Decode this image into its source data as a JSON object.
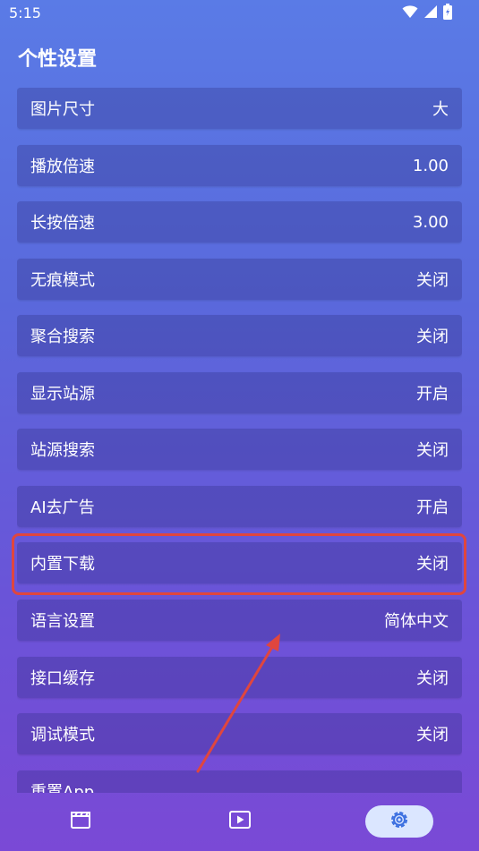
{
  "status_bar": {
    "time": "5:15",
    "icons": [
      "wifi-icon",
      "signal-icon",
      "battery-icon"
    ]
  },
  "page": {
    "title": "个性设置"
  },
  "settings": [
    {
      "label": "图片尺寸",
      "value": "大"
    },
    {
      "label": "播放倍速",
      "value": "1.00"
    },
    {
      "label": "长按倍速",
      "value": "3.00"
    },
    {
      "label": "无痕模式",
      "value": "关闭"
    },
    {
      "label": "聚合搜索",
      "value": "关闭"
    },
    {
      "label": "显示站源",
      "value": "开启"
    },
    {
      "label": "站源搜索",
      "value": "关闭"
    },
    {
      "label": "AI去广告",
      "value": "开启"
    },
    {
      "label": "内置下载",
      "value": "关闭"
    },
    {
      "label": "语言设置",
      "value": "简体中文"
    },
    {
      "label": "接口缓存",
      "value": "关闭"
    },
    {
      "label": "调试模式",
      "value": "关闭"
    },
    {
      "label": "重置App",
      "value": ""
    }
  ],
  "bottom_nav": {
    "items": [
      {
        "icon": "clapperboard-icon",
        "active": false
      },
      {
        "icon": "play-icon",
        "active": false
      },
      {
        "icon": "gear-icon",
        "active": true
      }
    ]
  },
  "colors": {
    "background_top": "#5a7be6",
    "background_bottom": "#7a49d6",
    "highlight": "#e0463e",
    "nav_active": "#dbe6ff",
    "nav_icon": "#ffffff",
    "nav_icon_active": "#3b6fe0"
  }
}
